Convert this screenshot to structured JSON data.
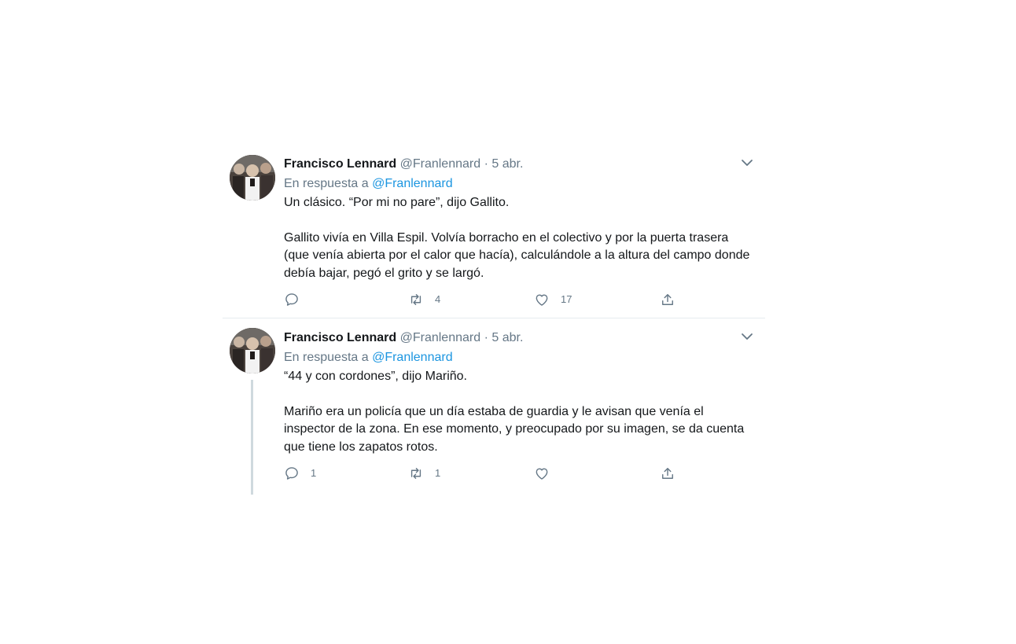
{
  "tweets": [
    {
      "author": {
        "name": "Francisco Lennard",
        "handle": "@Franlennard",
        "separator": "·",
        "date": "5 abr."
      },
      "reply_to": {
        "prefix": "En respuesta a",
        "mention": "@Franlennard"
      },
      "paragraphs": [
        "Un clásico. “Por mi no pare”, dijo Gallito.",
        "Gallito vivía en Villa Espil. Volvía borracho en el colectivo y por la puerta trasera (que venía abierta por el calor que hacía), calculándole a la altura del campo donde debía bajar, pegó el grito y se largó."
      ],
      "actions": {
        "reply_count": "",
        "retweet_count": "4",
        "like_count": "17"
      },
      "icons": {
        "reply": "reply-icon",
        "retweet": "retweet-icon",
        "like": "heart-icon",
        "share": "share-icon",
        "menu": "chevron-down-icon"
      }
    },
    {
      "author": {
        "name": "Francisco Lennard",
        "handle": "@Franlennard",
        "separator": "·",
        "date": "5 abr."
      },
      "reply_to": {
        "prefix": "En respuesta a",
        "mention": "@Franlennard"
      },
      "paragraphs": [
        "“44 y con cordones”, dijo Mariño.",
        "Mariño era un policía que un día estaba de guardia y le avisan que venía el inspector de la zona. En ese momento, y preocupado por su imagen, se da cuenta que tiene los zapatos rotos."
      ],
      "actions": {
        "reply_count": "1",
        "retweet_count": "1",
        "like_count": ""
      },
      "icons": {
        "reply": "reply-icon",
        "retweet": "retweet-icon",
        "like": "heart-icon",
        "share": "share-icon",
        "menu": "chevron-down-icon"
      }
    }
  ],
  "colors": {
    "text": "#14171a",
    "secondary": "#657786",
    "link": "#1b95e0",
    "divider": "#e6ecf0",
    "thread_line": "#cfd9de"
  }
}
